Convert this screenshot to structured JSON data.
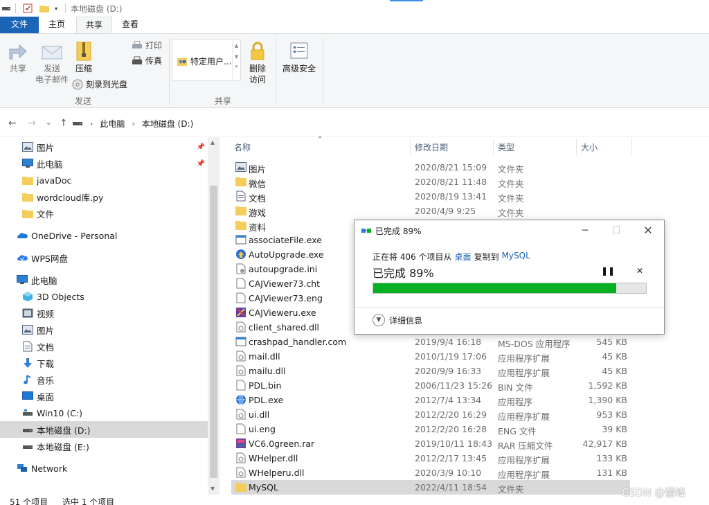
{
  "window": {
    "title": "本地磁盘 (D:)"
  },
  "ribbon": {
    "tabs": [
      {
        "label": "文件"
      },
      {
        "label": "主页"
      },
      {
        "label": "共享"
      },
      {
        "label": "查看"
      }
    ],
    "send_group": {
      "share": "共享",
      "email_line1": "发送",
      "email_line2": "电子邮件",
      "zip": "压缩",
      "print": "打印",
      "fax": "传真",
      "burn": "刻录到光盘",
      "label": "发送"
    },
    "share_group": {
      "specific_users": "特定用户...",
      "remove_line1": "删除",
      "remove_line2": "访问",
      "advanced": "高级安全",
      "label": "共享"
    }
  },
  "address": {
    "crumbs": [
      "此电脑",
      "本地磁盘 (D:)"
    ]
  },
  "sidebar": {
    "items": [
      {
        "label": "图片",
        "icon": "pictures-icon",
        "pinned": true
      },
      {
        "label": "此电脑",
        "icon": "computer-icon",
        "pinned": true
      },
      {
        "label": "javaDoc",
        "icon": "folder-icon"
      },
      {
        "label": "wordcloud库.py",
        "icon": "folder-icon"
      },
      {
        "label": "文件",
        "icon": "folder-icon"
      },
      {
        "label": "OneDrive - Personal",
        "icon": "onedrive-icon"
      },
      {
        "label": "WPS网盘",
        "icon": "wps-cloud-icon"
      },
      {
        "label": "此电脑",
        "icon": "computer-icon"
      },
      {
        "label": "3D Objects",
        "icon": "3d-objects-icon"
      },
      {
        "label": "视频",
        "icon": "videos-icon"
      },
      {
        "label": "图片",
        "icon": "pictures-icon"
      },
      {
        "label": "文档",
        "icon": "documents-icon"
      },
      {
        "label": "下载",
        "icon": "downloads-icon"
      },
      {
        "label": "音乐",
        "icon": "music-icon"
      },
      {
        "label": "桌面",
        "icon": "desktop-icon"
      },
      {
        "label": "Win10 (C:)",
        "icon": "drive-icon"
      },
      {
        "label": "本地磁盘 (D:)",
        "icon": "drive-icon",
        "selected": true
      },
      {
        "label": "本地磁盘 (E:)",
        "icon": "drive-icon"
      },
      {
        "label": "Network",
        "icon": "network-icon"
      }
    ]
  },
  "list": {
    "columns": {
      "name": "名称",
      "date": "修改日期",
      "type": "类型",
      "size": "大小"
    },
    "rows": [
      {
        "name": "图片",
        "date": "2020/8/21 15:09",
        "type": "文件夹",
        "size": "",
        "icon": "pictures-folder-icon"
      },
      {
        "name": "微信",
        "date": "2020/8/21 11:48",
        "type": "文件夹",
        "size": "",
        "icon": "folder-icon"
      },
      {
        "name": "文档",
        "date": "2020/8/19 13:41",
        "type": "文件夹",
        "size": "",
        "icon": "documents-folder-icon"
      },
      {
        "name": "游戏",
        "date": "2020/4/9 9:25",
        "type": "文件夹",
        "size": "",
        "icon": "folder-icon"
      },
      {
        "name": "资料",
        "date": "",
        "type": "",
        "size": "",
        "icon": "folder-icon"
      },
      {
        "name": "associateFile.exe",
        "date": "",
        "type": "",
        "size": "",
        "icon": "exe-icon"
      },
      {
        "name": "AutoUpgrade.exe",
        "date": "",
        "type": "",
        "size": "",
        "icon": "autoupgrade-icon"
      },
      {
        "name": "autoupgrade.ini",
        "date": "",
        "type": "",
        "size": "",
        "icon": "ini-file-icon"
      },
      {
        "name": "CAJViewer73.cht",
        "date": "",
        "type": "",
        "size": "",
        "icon": "file-icon"
      },
      {
        "name": "CAJViewer73.eng",
        "date": "",
        "type": "",
        "size": "",
        "icon": "file-icon"
      },
      {
        "name": "CAJVieweru.exe",
        "date": "",
        "type": "",
        "size": "",
        "icon": "cajviewer-icon"
      },
      {
        "name": "client_shared.dll",
        "date": "",
        "type": "",
        "size": "",
        "icon": "dll-icon"
      },
      {
        "name": "crashpad_handler.com",
        "date": "2019/9/4 16:18",
        "type": "MS-DOS 应用程序",
        "size": "545 KB",
        "icon": "exe-icon"
      },
      {
        "name": "mail.dll",
        "date": "2010/1/19 17:06",
        "type": "应用程序扩展",
        "size": "45 KB",
        "icon": "dll-icon"
      },
      {
        "name": "mailu.dll",
        "date": "2020/9/9 16:33",
        "type": "应用程序扩展",
        "size": "45 KB",
        "icon": "dll-icon"
      },
      {
        "name": "PDL.bin",
        "date": "2006/11/23 15:26",
        "type": "BIN 文件",
        "size": "1,592 KB",
        "icon": "file-icon"
      },
      {
        "name": "PDL.exe",
        "date": "2012/7/4 13:34",
        "type": "应用程序",
        "size": "1,390 KB",
        "icon": "globe-exe-icon"
      },
      {
        "name": "ui.dll",
        "date": "2012/2/20 16:29",
        "type": "应用程序扩展",
        "size": "953 KB",
        "icon": "dll-icon"
      },
      {
        "name": "ui.eng",
        "date": "2012/2/20 16:28",
        "type": "ENG 文件",
        "size": "39 KB",
        "icon": "file-icon"
      },
      {
        "name": "VC6.0green.rar",
        "date": "2019/10/11 18:43",
        "type": "RAR 压缩文件",
        "size": "42,917 KB",
        "icon": "rar-icon"
      },
      {
        "name": "WHelper.dll",
        "date": "2012/2/17 13:45",
        "type": "应用程序扩展",
        "size": "133 KB",
        "icon": "dll-icon"
      },
      {
        "name": "WHelperu.dll",
        "date": "2020/3/9 10:10",
        "type": "应用程序扩展",
        "size": "131 KB",
        "icon": "dll-icon"
      },
      {
        "name": "MySQL",
        "date": "2022/4/11 18:54",
        "type": "文件夹",
        "size": "",
        "icon": "folder-icon",
        "selected": true
      }
    ]
  },
  "status": {
    "count": "51 个项目",
    "selected": "选中 1 个项目"
  },
  "copy_dialog": {
    "title": "已完成 89%",
    "line_prefix": "正在将 406 个项目从",
    "source": "桌面",
    "line_mid": "复制到",
    "target": "MySQL",
    "big": "已完成 89%",
    "progress_percent": 89,
    "details": "详细信息"
  },
  "watermark": "CSDN @蕾峰",
  "colors": {
    "accent": "#1a65b5",
    "progress": "#06b025",
    "folder": "#f5cd5b",
    "selection": "#d9d9d9"
  }
}
